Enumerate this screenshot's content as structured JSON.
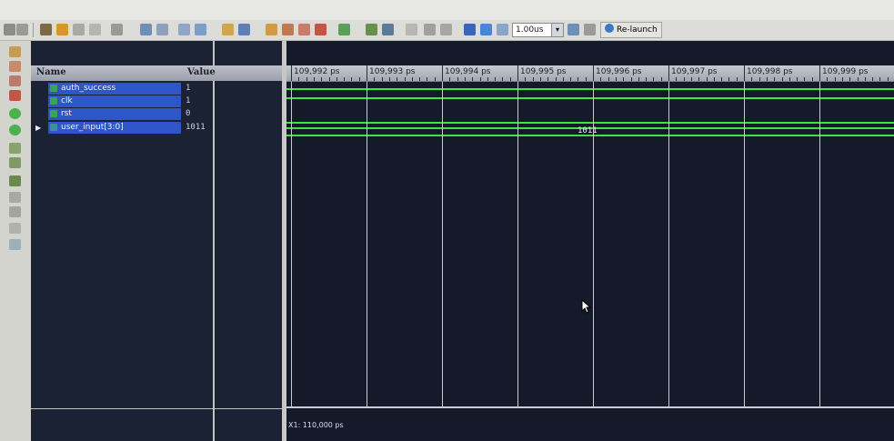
{
  "toolbar": {
    "time_value": "1.00us",
    "relaunch_label": "Re-launch"
  },
  "signals": {
    "header_name": "Name",
    "header_value": "Value",
    "rows": [
      {
        "name": "auth_success",
        "value": "1"
      },
      {
        "name": "clk",
        "value": "1"
      },
      {
        "name": "rst",
        "value": "0"
      },
      {
        "name": "user_input[3:0]",
        "value": "1011"
      }
    ]
  },
  "waveform": {
    "ticks": [
      "109,992 ps",
      "109,993 ps",
      "109,994 ps",
      "109,995 ps",
      "109,996 ps",
      "109,997 ps",
      "109,998 ps",
      "109,999 ps"
    ],
    "bus_value": "1011",
    "cursor_readout": "X1: 110,000 ps"
  },
  "colors": {
    "wave_green": "#3ce63c",
    "selection_blue": "#2f56c8",
    "wave_background": "#141a2a"
  }
}
